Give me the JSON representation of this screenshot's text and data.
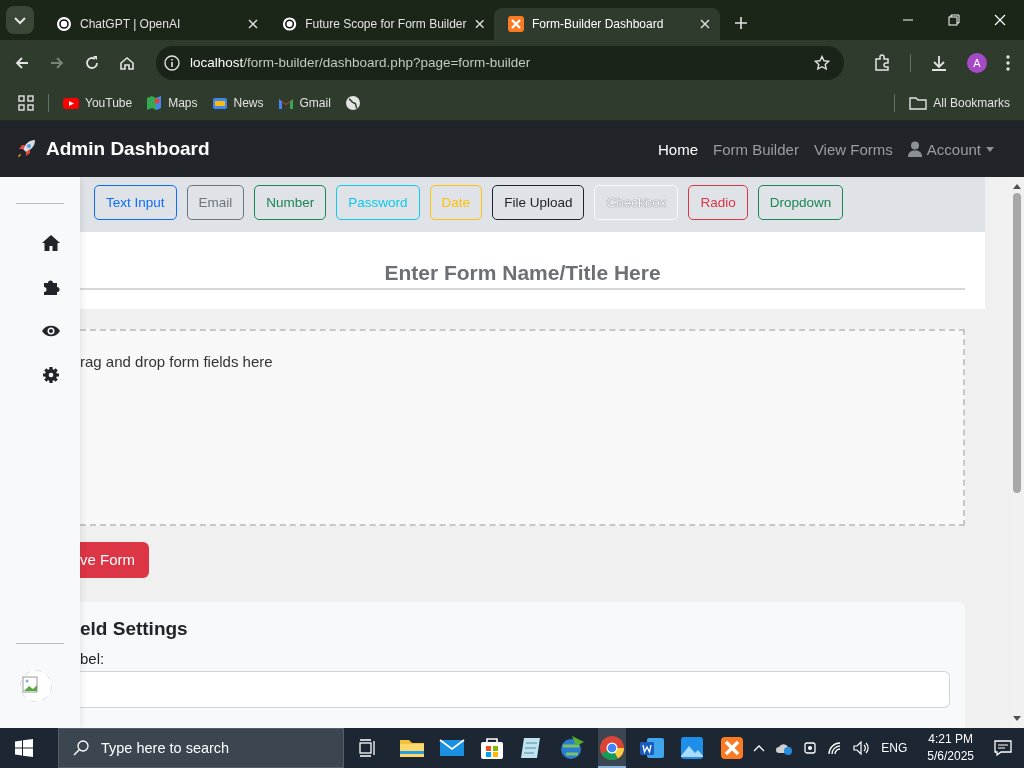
{
  "browser": {
    "tabs": [
      {
        "title": "ChatGPT | OpenAI",
        "selected": false
      },
      {
        "title": "Future Scope for Form Builder",
        "selected": false
      },
      {
        "title": "Form-Builder Dashboard",
        "selected": true
      }
    ],
    "address": {
      "host": "localhost",
      "path": "/form-builder/dashboard.php?page=form-builder"
    },
    "profile": "A",
    "bookmarks": [
      {
        "label": "YouTube"
      },
      {
        "label": "Maps"
      },
      {
        "label": "News"
      },
      {
        "label": "Gmail"
      }
    ],
    "all_bookmarks": "All Bookmarks"
  },
  "navbar": {
    "brand": "Admin Dashboard",
    "links": [
      {
        "label": "Home",
        "selected": true
      },
      {
        "label": "Form Builder",
        "selected": false
      },
      {
        "label": "View Forms",
        "selected": false
      }
    ],
    "account": "Account"
  },
  "field_types": [
    {
      "label": "Text Input",
      "color": "#0d6efd"
    },
    {
      "label": "Email",
      "color": "#6c757d"
    },
    {
      "label": "Number",
      "color": "#198754"
    },
    {
      "label": "Password",
      "color": "#0dcaf0"
    },
    {
      "label": "Date",
      "color": "#ffc107"
    },
    {
      "label": "File Upload",
      "color": "#212529"
    },
    {
      "label": "Checkbox",
      "color": "#f8f9fa"
    },
    {
      "label": "Radio",
      "color": "#dc3545"
    },
    {
      "label": "Dropdown",
      "color": "#198754"
    }
  ],
  "form_title": {
    "placeholder": "Enter Form Name/Title Here"
  },
  "dropzone": {
    "text": "rag and drop form fields here"
  },
  "save_button": "ve Form",
  "field_settings": {
    "heading": "eld Settings",
    "label": "bel:"
  },
  "taskbar": {
    "search_placeholder": "Type here to search",
    "language": "ENG",
    "time": "4:21 PM",
    "date": "5/6/2025"
  }
}
